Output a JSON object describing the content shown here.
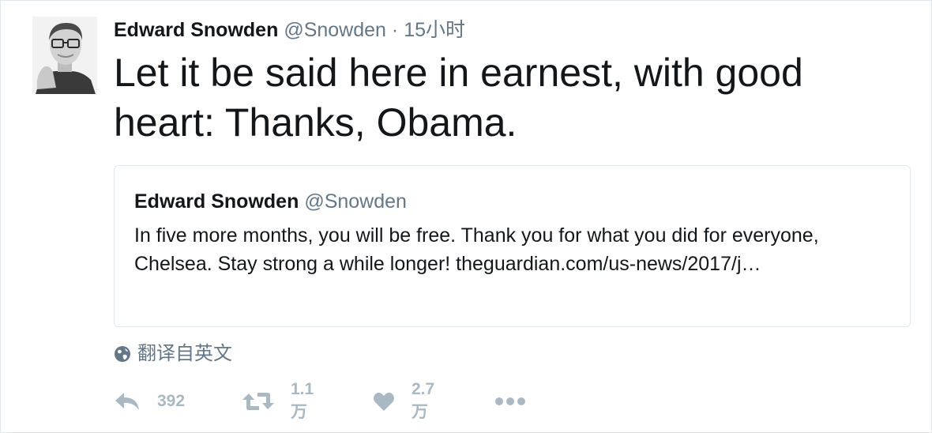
{
  "tweet": {
    "author_name": "Edward Snowden",
    "author_handle": "@Snowden",
    "separator": "·",
    "time": "15小时",
    "text": "Let it be said here in earnest, with good heart: Thanks, Obama."
  },
  "quoted_tweet": {
    "author_name": "Edward Snowden",
    "author_handle": "@Snowden",
    "text": "In five more months, you will be free. Thank you for what you did for everyone, Chelsea. Stay strong a while longer! theguardian.com/us-news/2017/j…"
  },
  "translate": {
    "label": "翻译自英文",
    "icon": "globe-icon"
  },
  "actions": {
    "reply_icon": "reply-icon",
    "reply_count": "392",
    "retweet_icon": "retweet-icon",
    "retweet_count": "1.1万",
    "like_icon": "heart-icon",
    "like_count": "2.7万",
    "more_icon": "more-icon"
  },
  "colors": {
    "text": "#14171a",
    "secondary": "#657786",
    "action_gray": "#aab8c2",
    "border": "#e1e8ed"
  }
}
